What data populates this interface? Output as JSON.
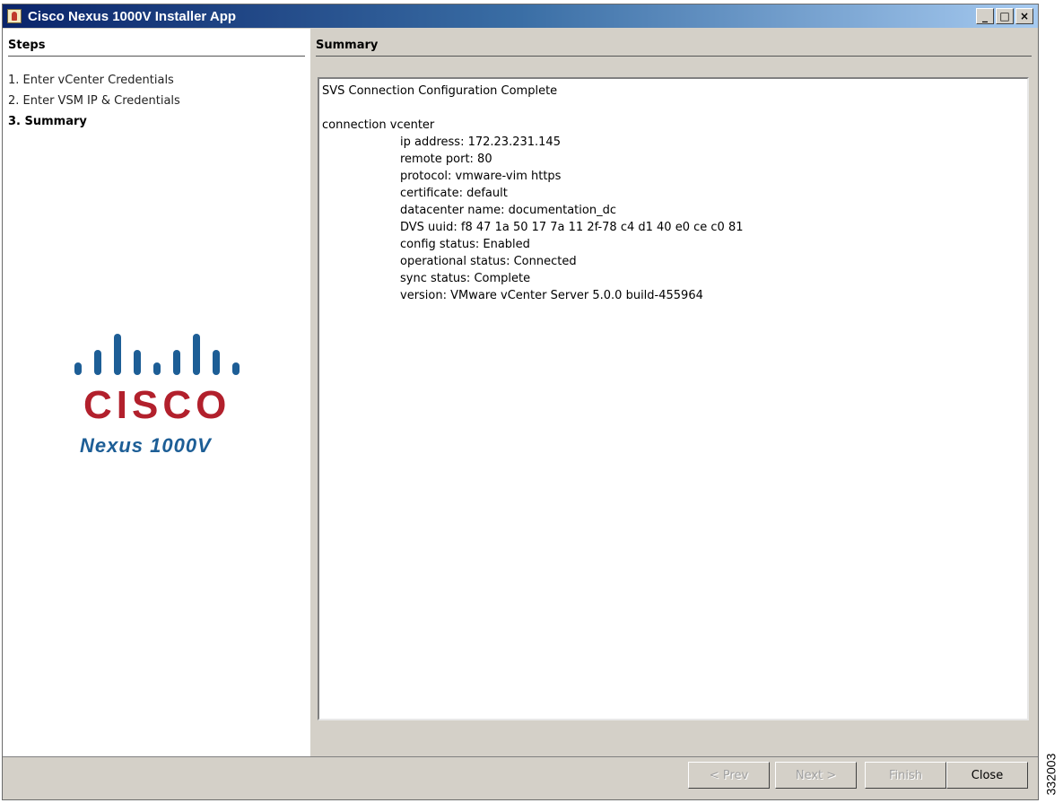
{
  "window": {
    "title": "Cisco Nexus 1000V Installer App",
    "controls": {
      "minimize": "_",
      "maximize": "□",
      "close": "×"
    }
  },
  "steps": {
    "header": "Steps",
    "items": [
      {
        "label": "1. Enter vCenter Credentials",
        "active": false
      },
      {
        "label": "2. Enter VSM IP & Credentials",
        "active": false
      },
      {
        "label": "3. Summary",
        "active": true
      }
    ]
  },
  "logo": {
    "wordmark": "CISCO",
    "product": "Nexus 1000V",
    "colors": {
      "bars": "#1d5e96",
      "wordmark": "#b2202c"
    }
  },
  "summary": {
    "header": "Summary",
    "status_line": "SVS Connection Configuration Complete",
    "connection_line": "connection vcenter",
    "details": [
      "ip address: 172.23.231.145",
      "remote port: 80",
      "protocol: vmware-vim https",
      "certificate: default",
      "datacenter name: documentation_dc",
      "DVS uuid: f8 47 1a 50 17 7a 11 2f-78 c4 d1 40 e0 ce c0 81",
      "config status: Enabled",
      "operational status: Connected",
      "sync status: Complete",
      "version: VMware vCenter Server 5.0.0 build-455964"
    ]
  },
  "buttons": {
    "prev": "< Prev",
    "next": "Next >",
    "finish": "Finish",
    "close": "Close"
  },
  "figure_id": "332003"
}
